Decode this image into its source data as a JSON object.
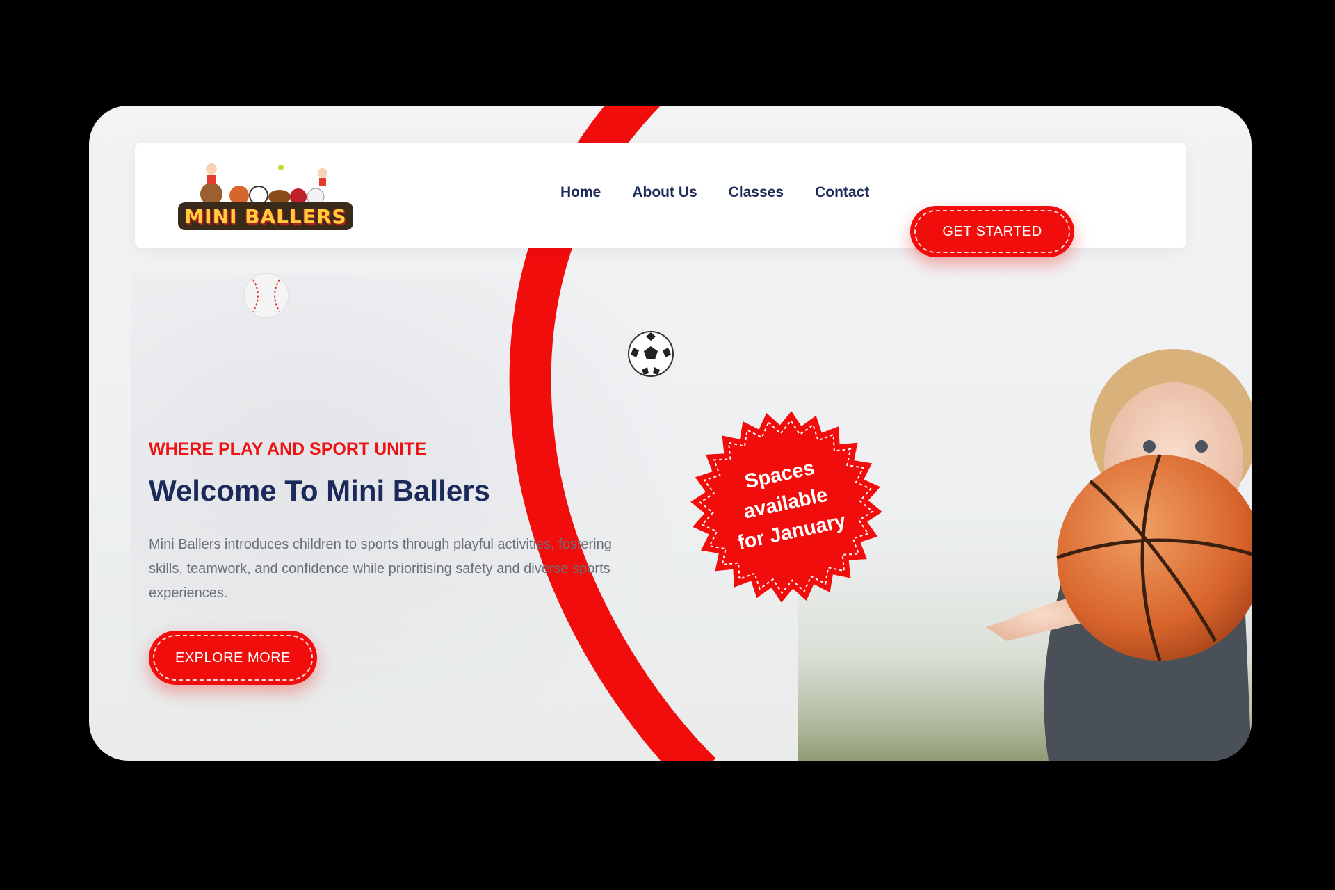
{
  "brand": {
    "logo_text": "MINI BALLERS"
  },
  "nav": {
    "items": [
      {
        "label": "Home"
      },
      {
        "label": "About Us"
      },
      {
        "label": "Classes"
      },
      {
        "label": "Contact"
      }
    ],
    "cta_label": "GET STARTED"
  },
  "hero": {
    "eyebrow": "WHERE PLAY AND SPORT UNITE",
    "title": "Welcome To Mini Ballers",
    "description": "Mini Ballers introduces children to sports through playful activities, fostering skills, teamwork, and confidence while prioritising safety and diverse sports experiences.",
    "cta_label": "EXPLORE MORE"
  },
  "badge": {
    "lines": [
      "Spaces",
      "available",
      "for January"
    ]
  },
  "colors": {
    "accent": "#f20d0d",
    "navy": "#1b2a5b",
    "text_muted": "#6b6f78"
  },
  "icons": [
    "baseball-icon",
    "soccer-ball-icon",
    "basketball-icon"
  ]
}
